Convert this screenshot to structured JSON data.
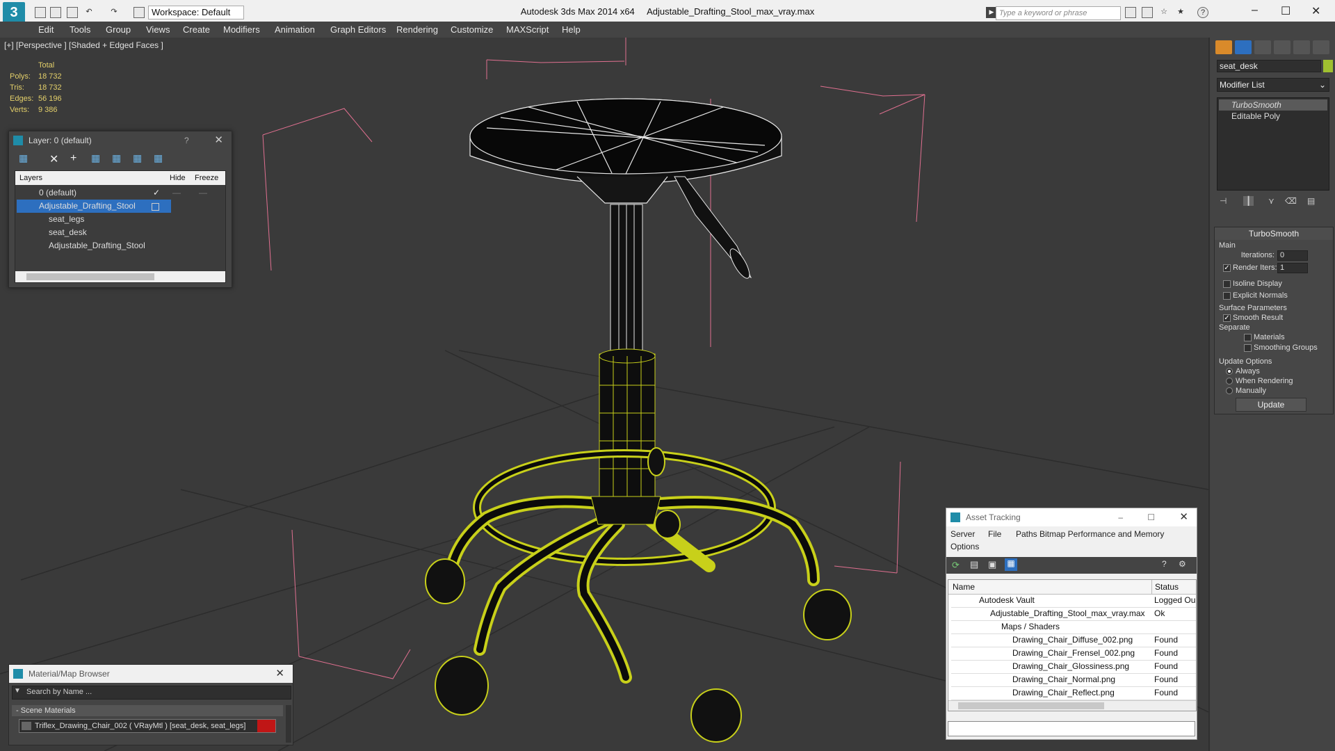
{
  "titlebar": {
    "app": "Autodesk 3ds Max  2014 x64",
    "file": "Adjustable_Drafting_Stool_max_vray.max",
    "workspace": "Workspace: Default",
    "search_placeholder": "Type a keyword or phrase"
  },
  "menu": [
    "Edit",
    "Tools",
    "Group",
    "Views",
    "Create",
    "Modifiers",
    "Animation",
    "Graph Editors",
    "Rendering",
    "Customize",
    "MAXScript",
    "Help"
  ],
  "viewport": {
    "label": "[+] [Perspective ] [Shaded + Edged Faces ]",
    "stats": {
      "header": "Total",
      "rows": [
        {
          "k": "Polys:",
          "v": "18 732"
        },
        {
          "k": "Tris:",
          "v": "18 732"
        },
        {
          "k": "Edges:",
          "v": "56 196"
        },
        {
          "k": "Verts:",
          "v": "9 386"
        }
      ]
    }
  },
  "layer_panel": {
    "title": "Layer: 0 (default)",
    "help": "?",
    "columns": {
      "name": "Layers",
      "hide": "Hide",
      "freeze": "Freeze"
    },
    "rows": [
      {
        "label": "0 (default)",
        "check": "✓"
      },
      {
        "label": "Adjustable_Drafting_Stool"
      },
      {
        "label": "seat_legs"
      },
      {
        "label": "seat_desk"
      },
      {
        "label": "Adjustable_Drafting_Stool"
      }
    ]
  },
  "command_panel": {
    "object_name": "seat_desk",
    "object_color": "#a0c030",
    "modifier_list": "Modifier List",
    "stack": [
      "TurboSmooth",
      "Editable Poly"
    ],
    "turbosmooth": {
      "title": "TurboSmooth",
      "main": "Main",
      "iterations_label": "Iterations:",
      "iterations": "0",
      "render_iters_label": "Render Iters:",
      "render_iters": "1",
      "isoline": "Isoline Display",
      "explicit_normals": "Explicit Normals",
      "surface_params": "Surface Parameters",
      "smooth_result": "Smooth Result",
      "separate": "Separate",
      "materials": "Materials",
      "smoothing_groups": "Smoothing Groups",
      "update_options": "Update Options",
      "always": "Always",
      "when_rendering": "When Rendering",
      "manually": "Manually",
      "update_button": "Update"
    }
  },
  "asset_tracking": {
    "title": "Asset Tracking",
    "menus": [
      "Server",
      "File",
      "Paths",
      "Bitmap Performance and Memory"
    ],
    "options": "Options",
    "columns": {
      "name": "Name",
      "status": "Status"
    },
    "rows": [
      {
        "name": "Autodesk Vault",
        "status": "Logged Ou"
      },
      {
        "name": "Adjustable_Drafting_Stool_max_vray.max",
        "status": "Ok"
      },
      {
        "name": "Maps / Shaders",
        "status": ""
      },
      {
        "name": "Drawing_Chair_Diffuse_002.png",
        "status": "Found"
      },
      {
        "name": "Drawing_Chair_Frensel_002.png",
        "status": "Found"
      },
      {
        "name": "Drawing_Chair_Glossiness.png",
        "status": "Found"
      },
      {
        "name": "Drawing_Chair_Normal.png",
        "status": "Found"
      },
      {
        "name": "Drawing_Chair_Reflect.png",
        "status": "Found"
      }
    ]
  },
  "material_browser": {
    "title": "Material/Map Browser",
    "search_placeholder": "Search by Name ...",
    "section": "Scene Materials",
    "material": "Triflex_Drawing_Chair_002  ( VRayMtl )  [seat_desk, seat_legs]"
  }
}
